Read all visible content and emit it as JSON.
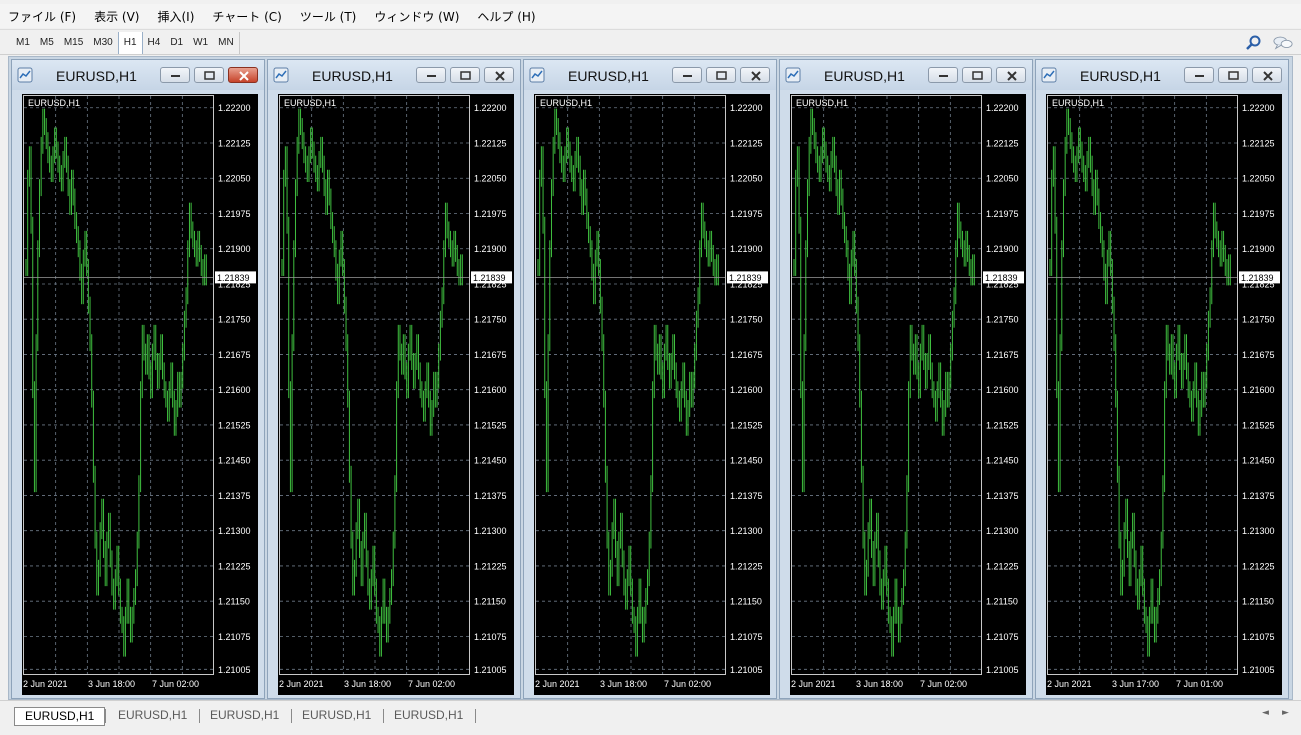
{
  "menu": [
    "ファイル (F)",
    "表示 (V)",
    "挿入(I)",
    "チャート (C)",
    "ツール (T)",
    "ウィンドウ (W)",
    "ヘルプ (H)"
  ],
  "timeframes": [
    "M1",
    "M5",
    "M15",
    "M30",
    "H1",
    "H4",
    "D1",
    "W1",
    "MN"
  ],
  "active_timeframe": "H1",
  "toolbar_icons": [
    "search-icon",
    "chat-icon"
  ],
  "charts": [
    {
      "title": "EURUSD,H1",
      "label": "EURUSD,H1",
      "current_price": "1.21839",
      "x_labels": [
        "2 Jun 2021",
        "3 Jun 18:00",
        "7 Jun 02:00"
      ],
      "active": true
    },
    {
      "title": "EURUSD,H1",
      "label": "EURUSD,H1",
      "current_price": "1.21839",
      "x_labels": [
        "2 Jun 2021",
        "3 Jun 18:00",
        "7 Jun 02:00"
      ],
      "active": false
    },
    {
      "title": "EURUSD,H1",
      "label": "EURUSD,H1",
      "current_price": "1.21839",
      "x_labels": [
        "2 Jun 2021",
        "3 Jun 18:00",
        "7 Jun 02:00"
      ],
      "active": false
    },
    {
      "title": "EURUSD,H1",
      "label": "EURUSD,H1",
      "current_price": "1.21839",
      "x_labels": [
        "2 Jun 2021",
        "3 Jun 18:00",
        "7 Jun 02:00"
      ],
      "active": false
    },
    {
      "title": "EURUSD,H1",
      "label": "EURUSD,H1",
      "current_price": "1.21839",
      "x_labels": [
        "2 Jun 2021",
        "3 Jun 17:00",
        "7 Jun 01:00"
      ],
      "active": false
    }
  ],
  "price_ticks": [
    "1.22200",
    "1.22125",
    "1.22050",
    "1.21975",
    "1.21900",
    "1.21825",
    "1.21750",
    "1.21675",
    "1.21600",
    "1.21525",
    "1.21450",
    "1.21375",
    "1.21300",
    "1.21225",
    "1.21150",
    "1.21075",
    "1.21005"
  ],
  "price_series": [
    1.2186,
    1.2205,
    1.221,
    1.2195,
    1.216,
    1.214,
    1.217,
    1.219,
    1.2203,
    1.2212,
    1.2218,
    1.2216,
    1.2213,
    1.221,
    1.2208,
    1.2206,
    1.221,
    1.2214,
    1.2211,
    1.2208,
    1.2206,
    1.2204,
    1.2209,
    1.2212,
    1.2208,
    1.2203,
    1.2199,
    1.2205,
    1.2201,
    1.2196,
    1.2193,
    1.219,
    1.2185,
    1.218,
    1.2188,
    1.2192,
    1.2186,
    1.2178,
    1.217,
    1.2158,
    1.2142,
    1.2128,
    1.2118,
    1.2122,
    1.213,
    1.2135,
    1.2126,
    1.212,
    1.2128,
    1.2132,
    1.2124,
    1.2118,
    1.2115,
    1.212,
    1.2125,
    1.2118,
    1.2112,
    1.211,
    1.2105,
    1.2112,
    1.2118,
    1.2112,
    1.2108,
    1.2112,
    1.2116,
    1.212,
    1.2128,
    1.214,
    1.216,
    1.2172,
    1.2168,
    1.2165,
    1.217,
    1.2164,
    1.216,
    1.2168,
    1.2172,
    1.2166,
    1.2162,
    1.2166,
    1.217,
    1.2164,
    1.216,
    1.2158,
    1.2155,
    1.216,
    1.2164,
    1.2158,
    1.2152,
    1.2156,
    1.2162,
    1.2158,
    1.2162,
    1.2168,
    1.2175,
    1.218,
    1.219,
    1.2198,
    1.2194,
    1.2192,
    1.219,
    1.2188,
    1.2192,
    1.2189,
    1.2186,
    1.2184,
    1.2187,
    1.2184
  ],
  "tabs": [
    "EURUSD,H1",
    "EURUSD,H1",
    "EURUSD,H1",
    "EURUSD,H1",
    "EURUSD,H1"
  ],
  "colors": {
    "candle": "#3fbf3f",
    "grid": "#6e7a88",
    "price_box": "#ffffff",
    "background": "#000000"
  }
}
